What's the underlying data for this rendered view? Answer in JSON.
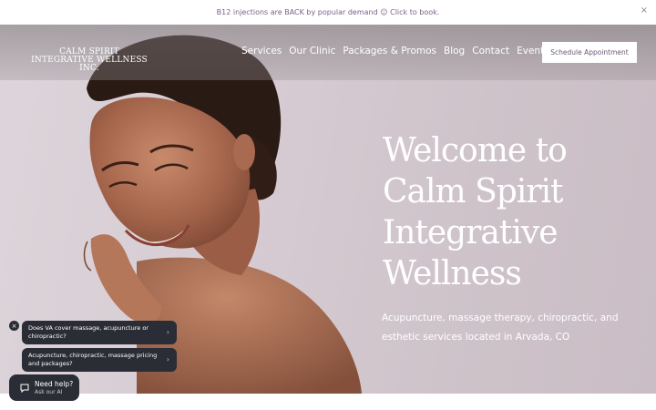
{
  "announcement": {
    "text": "B12 injections are BACK by popular demand ☺ Click to book.",
    "close": "×"
  },
  "brand": {
    "line1": "CALM SPIRIT",
    "line2": "INTEGRATIVE WELLNESS INC."
  },
  "nav": {
    "items": [
      "Services",
      "Our Clinic",
      "Packages & Promos",
      "Blog",
      "Contact",
      "Events"
    ]
  },
  "cta": {
    "label": "Schedule Appointment"
  },
  "hero": {
    "headline_lines": [
      "Welcome to",
      "Calm Spirit",
      "Integrative",
      "Wellness"
    ],
    "subtitle": "Acupuncture, massage therapy, chiropractic, and esthetic services located in Arvada, CO"
  },
  "chat": {
    "close": "×",
    "suggestions": [
      "Does VA cover massage, acupuncture or chiropractic?",
      "Acupuncture, chiropractic, massage pricing and packages?"
    ],
    "help_title": "Need help?",
    "help_sub": "Ask our AI"
  },
  "colors": {
    "accent": "#7b5f86",
    "chat_bg": "#2b2d36"
  }
}
